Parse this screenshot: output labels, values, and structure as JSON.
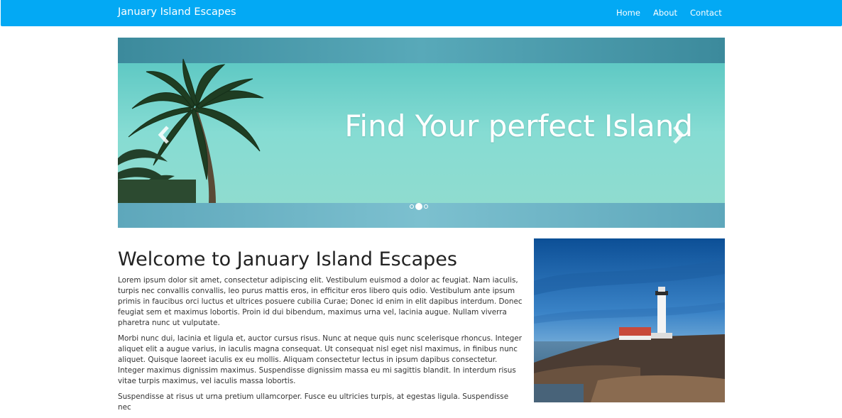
{
  "navbar": {
    "brand": "January Island Escapes",
    "links": [
      "Home",
      "About",
      "Contact"
    ],
    "background": "#03a9f4"
  },
  "carousel": {
    "heading": "Find Your perfect Island",
    "prev_icon": "chevron-left-icon",
    "next_icon": "chevron-right-icon",
    "slide_count": 3,
    "active_slide": 2
  },
  "main": {
    "title": "Welcome to January Island Escapes",
    "paragraphs": [
      "Lorem ipsum dolor sit amet, consectetur adipiscing elit. Vestibulum euismod a dolor ac feugiat. Nam iaculis, turpis nec convallis convallis, leo purus mattis eros, in efficitur eros libero quis odio. Vestibulum ante ipsum primis in faucibus orci luctus et ultrices posuere cubilia Curae; Donec id enim in elit dapibus interdum. Donec feugiat sem et maximus lobortis. Proin id dui bibendum, maximus urna vel, lacinia augue. Nullam viverra pharetra nunc ut vulputate.",
      "Morbi nunc dui, lacinia et ligula et, auctor cursus risus. Nunc at neque quis nunc scelerisque rhoncus. Integer aliquet elit a augue varius, in iaculis magna consequat. Ut consequat nisl eget nisl maximus, in finibus nunc aliquet. Quisque laoreet iaculis ex eu mollis. Aliquam consectetur lectus in ipsum dapibus consectetur. Integer maximus dignissim maximus. Suspendisse dignissim massa eu mi sagittis blandit. In interdum risus vitae turpis maximus, vel iaculis massa lobortis.",
      "Suspendisse at risus ut urna pretium ullamcorper. Fusce eu ultricies turpis, at egestas ligula. Suspendisse nec"
    ]
  },
  "side_image": {
    "subject": "lighthouse-photo"
  }
}
